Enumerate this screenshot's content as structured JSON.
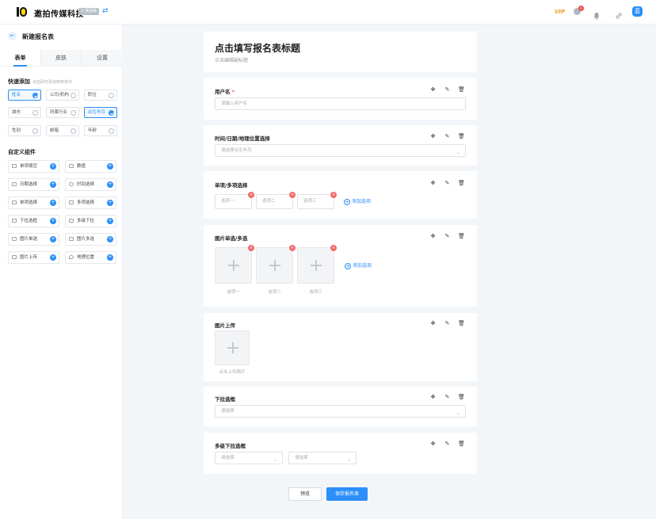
{
  "header": {
    "brand": "邀拍传媒科技",
    "version_badge": "V 体验版",
    "swap_icon": "⇄",
    "vip_label": "VIP",
    "msg_count": "4",
    "avatar_initial": "蓝"
  },
  "sidebar": {
    "back_icon": "←",
    "title": "新建报名表",
    "tabs": [
      "表单",
      "皮肤",
      "设置"
    ],
    "quick_add": {
      "title": "快速添加",
      "hint": "点击即可添加到表单中",
      "chips": [
        {
          "label": "姓名",
          "selected": true
        },
        {
          "label": "公司/机构",
          "selected": false
        },
        {
          "label": "职位",
          "selected": false
        },
        {
          "label": "城市",
          "selected": false
        },
        {
          "label": "所属行业",
          "selected": false
        },
        {
          "label": "出生年月",
          "selected": true
        },
        {
          "label": "性别",
          "selected": false
        },
        {
          "label": "邮箱",
          "selected": false
        },
        {
          "label": "年龄",
          "selected": false
        }
      ]
    },
    "custom": {
      "title": "自定义组件",
      "items": [
        "单项填空",
        "数值",
        "日期选择",
        "时间选择",
        "单项选择",
        "多项选择",
        "下拉选框",
        "多级下拉",
        "图片单选",
        "图片多选",
        "图片上传",
        "地理位置"
      ]
    }
  },
  "form": {
    "title": "点击填写报名表标题",
    "subtitle": "点击编辑副标题",
    "fields": [
      {
        "label": "用户名",
        "required": "*",
        "placeholder": "请输入用户名"
      },
      {
        "label": "时间/日期/地理位置选择",
        "placeholder": "请选择出生年月"
      },
      {
        "label": "单项/多项选择",
        "options": [
          "选项一",
          "选项二",
          "选项三"
        ],
        "add": "添加选项"
      },
      {
        "label": "图片单选/多选",
        "options": [
          "选项一",
          "选项二",
          "选项三"
        ],
        "add": "添加选项"
      },
      {
        "label": "图片上传",
        "hint": "点击上传照片"
      },
      {
        "label": "下拉选框",
        "placeholder": "请选择"
      },
      {
        "label": "多级下拉选框",
        "placeholder1": "请选择",
        "placeholder2": "请选择"
      }
    ],
    "op_icons": {
      "move": "✥",
      "edit": "✎",
      "delete": "🗑"
    },
    "chevron": "⌄",
    "remove_icon": "×",
    "add_icon": "+"
  },
  "actions": {
    "preview": "预览",
    "save": "保存报名表"
  }
}
